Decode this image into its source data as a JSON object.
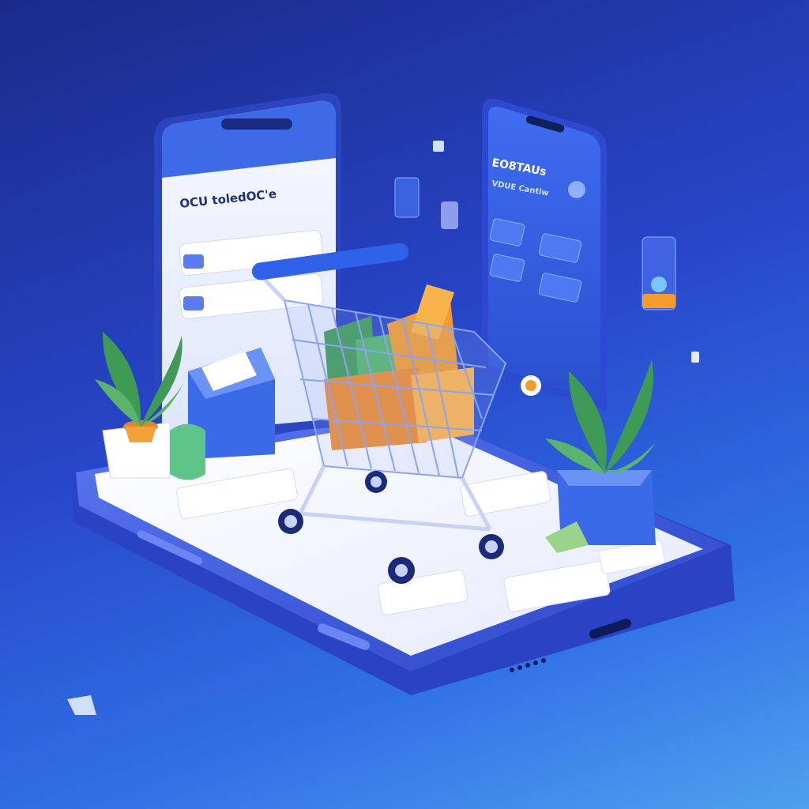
{
  "scene": {
    "description_free": true,
    "left_phone": {
      "title": "OCU toledOC'e",
      "screen_color": "#e9eefc",
      "frame_color": "#3a55d6"
    },
    "right_phone": {
      "title": "EO8TAUs",
      "subtitle": "VDUE Cantiw",
      "screen_color": "#2f57d8",
      "frame_color": "#4a6ce6"
    },
    "colors": {
      "bg_top": "#1b2a8a",
      "bg_bottom": "#4fa0ee",
      "device_frame": "#3b5bdc",
      "device_screen": "#f3f5fd",
      "cart_blue": "#2f62e8",
      "box_orange": "#f59a2c",
      "box_green": "#52b56a",
      "plant_green": "#3f9a55",
      "pot_orange": "#f4a13a"
    },
    "icons": [
      "shopping-cart-icon",
      "plant-icon",
      "box-icon",
      "floating-card-icon"
    ]
  }
}
